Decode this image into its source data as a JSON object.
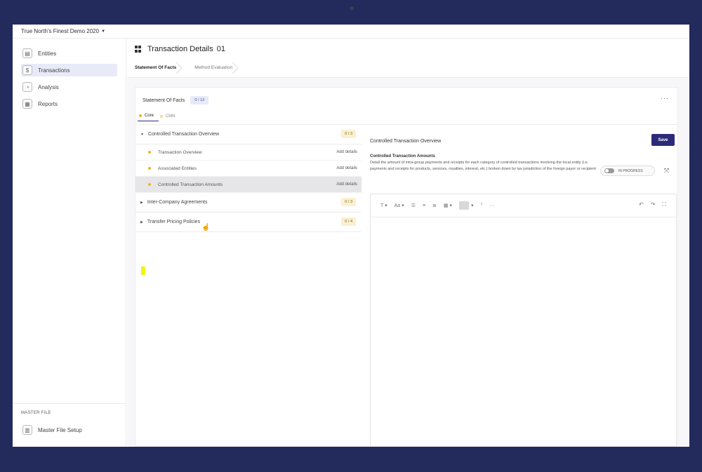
{
  "workspace": {
    "name": "True North's Finest Demo 2020"
  },
  "sidebar": {
    "items": [
      {
        "label": "Entities",
        "icon": "document-icon"
      },
      {
        "label": "Transactions",
        "icon": "dollar-icon"
      },
      {
        "label": "Analysis",
        "icon": "chart-pie-icon"
      },
      {
        "label": "Reports",
        "icon": "report-icon"
      }
    ],
    "master_file": {
      "section_label": "MASTER FILE",
      "item_label": "Master File Setup"
    }
  },
  "page": {
    "title": "Transaction Details",
    "title_number": "01",
    "steps": [
      "Statement Of Facts",
      "Method Evaluation"
    ]
  },
  "card": {
    "heading": "Statement Of Facts",
    "progress": "0 / 13",
    "tabs": [
      "Core",
      "CblN"
    ]
  },
  "groups": [
    {
      "label": "Controlled Transaction Overview",
      "count": "0 / 3",
      "rows": [
        {
          "label": "Transaction Overview",
          "action": "Add details"
        },
        {
          "label": "Associated Entities",
          "action": "Add details"
        },
        {
          "label": "Controlled Transaction Amounts",
          "action": "Add details"
        }
      ]
    },
    {
      "label": "Inter-Company Agreements",
      "count": "0 / 3"
    },
    {
      "label": "Transfer Pricing Policies",
      "count": "0 / 4"
    }
  ],
  "detail": {
    "section_title": "Controlled Transaction Overview",
    "save_label": "Save",
    "field_title": "Controlled Transaction Amounts",
    "field_description": "Detail the amount of intra-group payments and receipts for each category of controlled transactions involving the local entity (i.e. payments and receipts for products, services, royalties, interest, etc.) broken down by tax jurisdiction of the foreign payor or recipient",
    "status": "IN PROGRESS"
  },
  "editor": {
    "toolbar": {
      "text_style": "T",
      "font_size": "Aa"
    }
  }
}
